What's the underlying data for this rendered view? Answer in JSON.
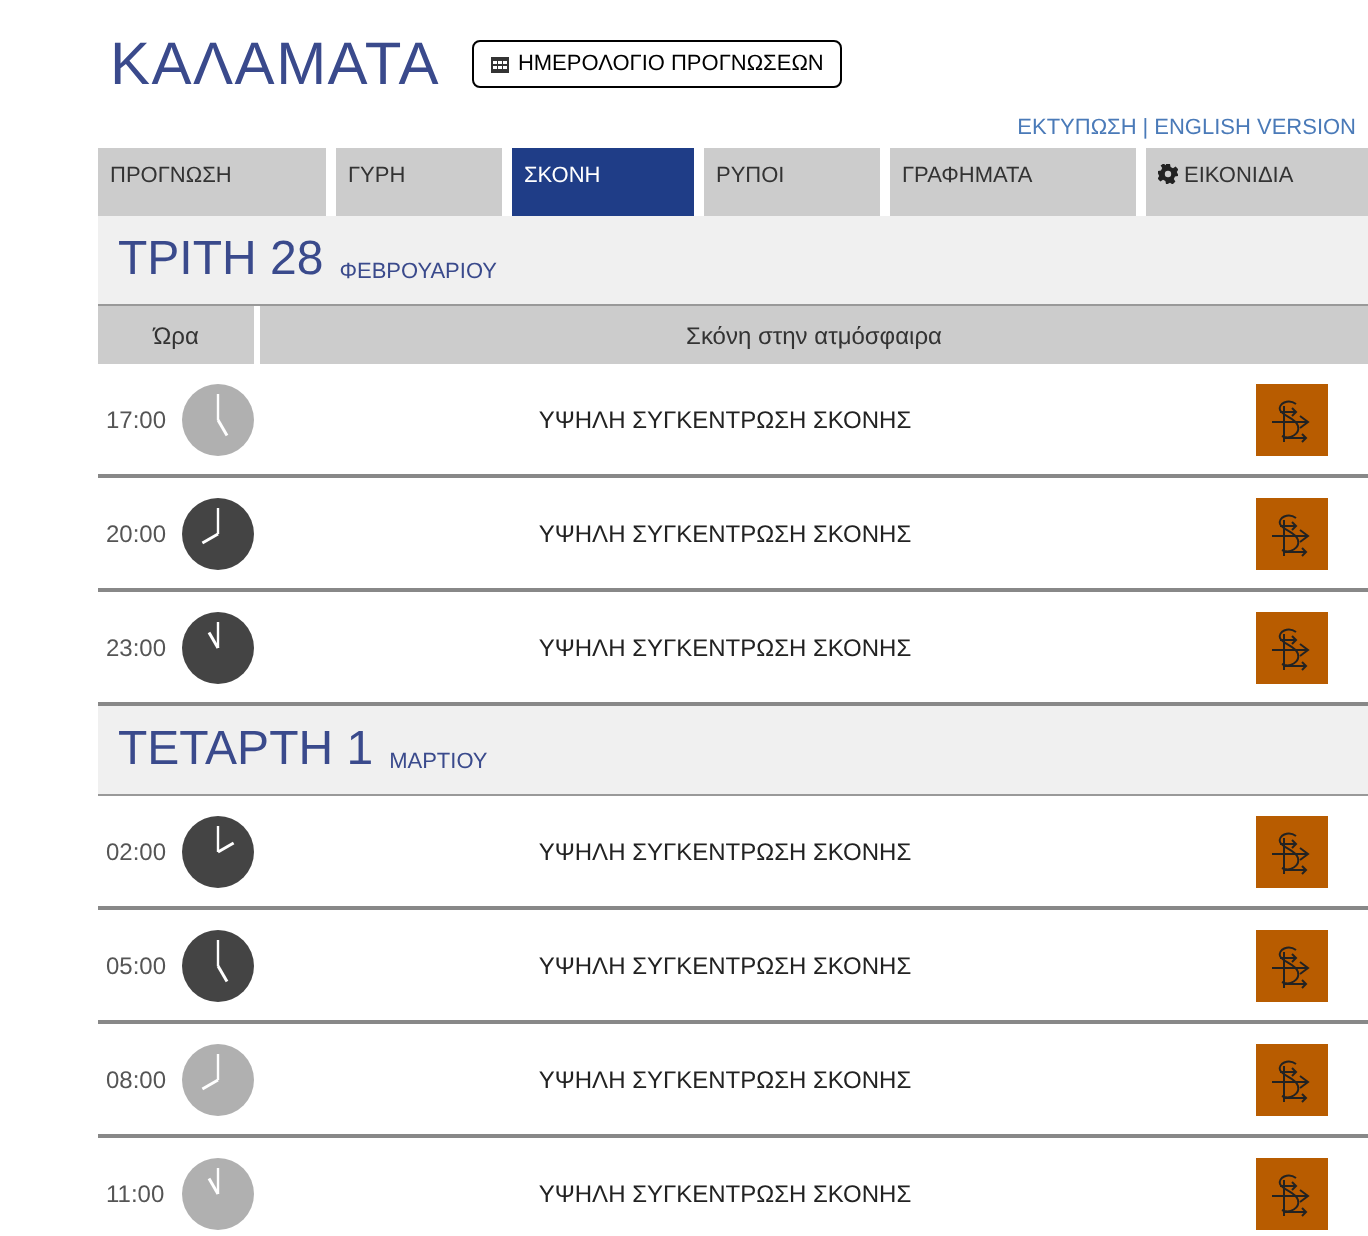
{
  "city": "ΚΑΛΑΜΑΤΑ",
  "calendar_button": "ΗΜΕΡΟΛΟΓΙΟ ΠΡΟΓΝΩΣΕΩΝ",
  "links": [
    "ΕΚΤΥΠΩΣΗ",
    "|",
    "ENGLISH VERSION"
  ],
  "tabs": [
    {
      "label": "ΠΡΟΓΝΩΣΗ",
      "selected": false
    },
    {
      "label": "ΓΥΡΗ",
      "selected": false
    },
    {
      "label": "ΣΚΟΝΗ",
      "selected": true
    },
    {
      "label": "ΡΥΠΟΙ",
      "selected": false
    },
    {
      "label": "ΓΡΑΦΗΜΑΤΑ",
      "selected": false
    },
    {
      "label": "ΕΙΚΟΝΙΔΙΑ",
      "selected": false,
      "kind": "gear"
    }
  ],
  "columns": [
    "Ώρα",
    "Σκόνη στην ατμόσφαιρα"
  ],
  "days": [
    {
      "day": "ΤΡΙΤΗ 28",
      "month": "ΦΕΒΡΟΥΑΡΙΟΥ",
      "rows": [
        {
          "time": "17:00",
          "night": false,
          "text": "ΥΨΗΛΗ ΣΥΓΚΕΝΤΡΩΣΗ ΣΚΟΝΗΣ",
          "color": "#b85c00"
        },
        {
          "time": "20:00",
          "night": true,
          "text": "ΥΨΗΛΗ ΣΥΓΚΕΝΤΡΩΣΗ ΣΚΟΝΗΣ",
          "color": "#b85c00"
        },
        {
          "time": "23:00",
          "night": true,
          "text": "ΥΨΗΛΗ ΣΥΓΚΕΝΤΡΩΣΗ ΣΚΟΝΗΣ",
          "color": "#b85c00"
        }
      ]
    },
    {
      "day": "ΤΕΤΑΡΤΗ 1",
      "month": "ΜΑΡΤΙΟΥ",
      "rows": [
        {
          "time": "02:00",
          "night": true,
          "text": "ΥΨΗΛΗ ΣΥΓΚΕΝΤΡΩΣΗ ΣΚΟΝΗΣ",
          "color": "#b85c00"
        },
        {
          "time": "05:00",
          "night": true,
          "text": "ΥΨΗΛΗ ΣΥΓΚΕΝΤΡΩΣΗ ΣΚΟΝΗΣ",
          "color": "#b85c00"
        },
        {
          "time": "08:00",
          "night": false,
          "text": "ΥΨΗΛΗ ΣΥΓΚΕΝΤΡΩΣΗ ΣΚΟΝΗΣ",
          "color": "#b85c00"
        },
        {
          "time": "11:00",
          "night": false,
          "text": "ΥΨΗΛΗ ΣΥΓΚΕΝΤΡΩΣΗ ΣΚΟΝΗΣ",
          "color": "#b85c00"
        }
      ]
    }
  ]
}
